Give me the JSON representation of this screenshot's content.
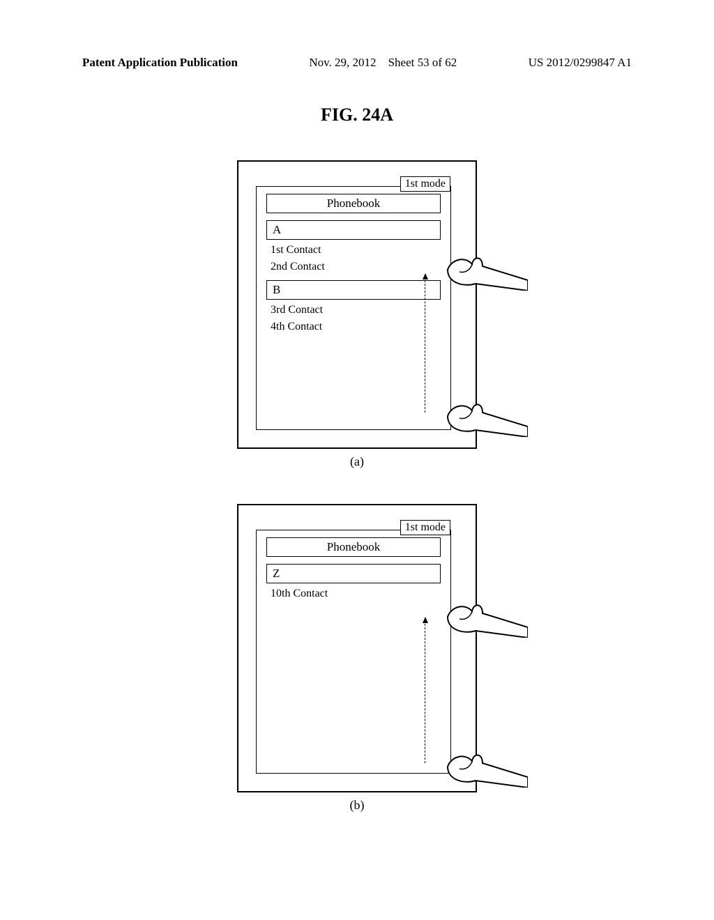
{
  "header": {
    "publication_type": "Patent Application Publication",
    "date": "Nov. 29, 2012",
    "sheet": "Sheet 53 of 62",
    "pub_number": "US 2012/0299847 A1"
  },
  "figure_label": "FIG. 24A",
  "sublabels": {
    "a": "(a)",
    "b": "(b)"
  },
  "panel_a": {
    "mode_badge": "1st mode",
    "phonebook_label": "Phonebook",
    "section_A": "A",
    "contacts_A": [
      "1st Contact",
      "2nd Contact"
    ],
    "section_B": "B",
    "contacts_B": [
      "3rd Contact",
      "4th Contact"
    ]
  },
  "panel_b": {
    "mode_badge": "1st mode",
    "phonebook_label": "Phonebook",
    "section_Z": "Z",
    "contacts_Z": [
      "10th Contact"
    ]
  }
}
